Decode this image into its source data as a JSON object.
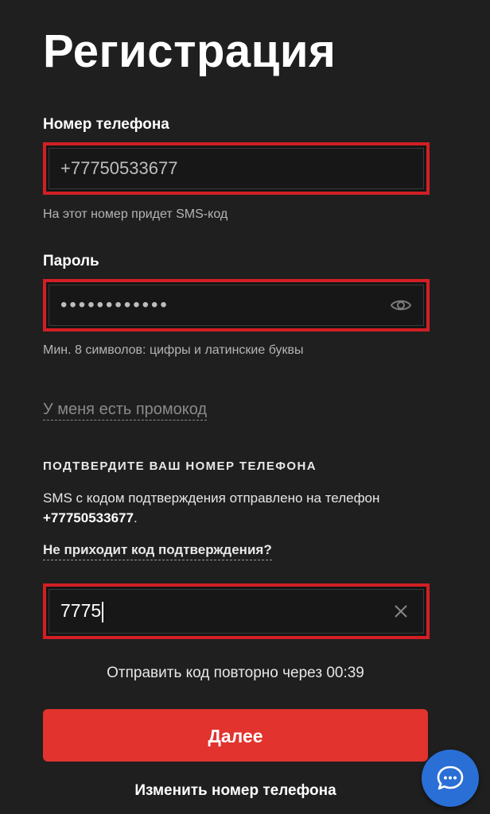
{
  "page": {
    "title": "Регистрация"
  },
  "phone": {
    "label": "Номер телефона",
    "value": "+77750533677",
    "hint": "На этот номер придет SMS-код"
  },
  "password": {
    "label": "Пароль",
    "masked_value": "••••••••••••",
    "hint": "Мин. 8 символов: цифры и латинские буквы"
  },
  "promo": {
    "link_text": "У меня есть промокод"
  },
  "confirm": {
    "heading": "ПОДТВЕРДИТЕ ВАШ НОМЕР ТЕЛЕФОНА",
    "sms_text_prefix": "SMS с кодом подтверждения отправлено на телефон ",
    "sms_phone": "+77750533677",
    "sms_text_suffix": ".",
    "no_code_link": "Не приходит код подтверждения?",
    "code_value": "7775",
    "resend_text": "Отправить код повторно через 00:39"
  },
  "actions": {
    "next_label": "Далее",
    "change_phone_label": "Изменить номер телефона"
  },
  "colors": {
    "background": "#1f1f1f",
    "accent_red": "#e2332e",
    "highlight_border": "#d21f24",
    "chat_blue": "#2a6fd6"
  },
  "icons": {
    "password_toggle": "eye-icon",
    "clear": "close-icon",
    "chat": "chat-bubble-icon"
  }
}
